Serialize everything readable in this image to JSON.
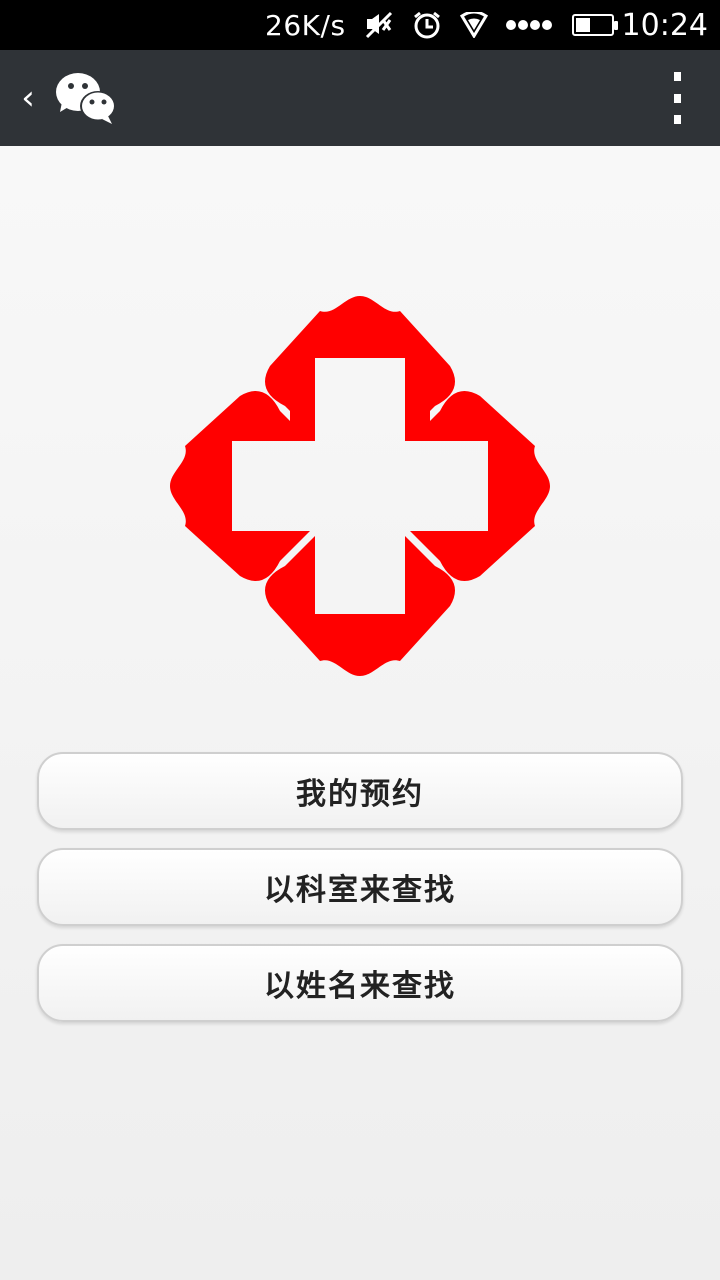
{
  "status_bar": {
    "speed": "26K/s",
    "time": "10:24",
    "icons": [
      "mute-icon",
      "alarm-icon",
      "wifi-icon",
      "signal-icon",
      "battery-icon"
    ]
  },
  "title_bar": {
    "back_label": "‹",
    "app_icon": "wechat-icon",
    "menu_icon": "more-vertical-icon"
  },
  "logo": {
    "icon": "red-cross-icon",
    "color": "#ff0000"
  },
  "menu": {
    "items": [
      {
        "label": "我的预约"
      },
      {
        "label": "以科室来查找"
      },
      {
        "label": "以姓名来查找"
      }
    ]
  }
}
